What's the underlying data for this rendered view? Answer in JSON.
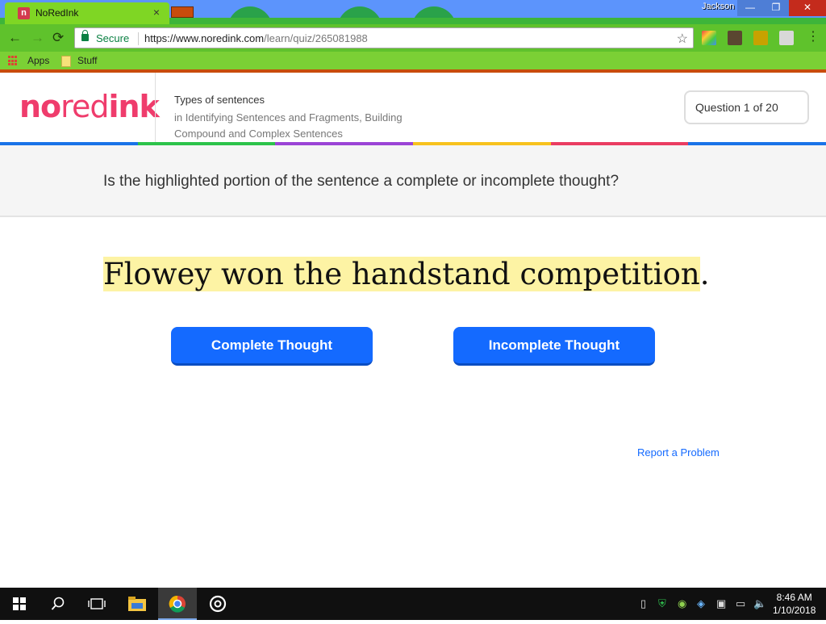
{
  "browser": {
    "tab_title": "NoRedInk",
    "tab_close": "×",
    "favicon_letter": "n",
    "profile_name": "Jackson",
    "window_buttons": {
      "minimize": "—",
      "maximize": "❐",
      "close": "✕"
    },
    "nav": {
      "back": "←",
      "forward": "→",
      "reload": "⟳"
    },
    "secure_label": "Secure",
    "url_host": "https://www.noredink.com",
    "url_path": "/learn/quiz/265081988",
    "star": "☆",
    "menu": "⋮",
    "bookmarks": [
      {
        "label": "Apps"
      },
      {
        "label": "Stuff"
      }
    ]
  },
  "header": {
    "logo": {
      "part1": "no",
      "part2": "red",
      "part3": "ink"
    },
    "topic": "Types of sentences",
    "topic_sub": "in Identifying Sentences and Fragments, Building Compound and Complex Sentences",
    "question_counter": "Question 1 of 20"
  },
  "colors": {
    "brand": "#ef3c6c",
    "button_blue": "#146aff",
    "highlight": "#fdf3a4",
    "rainbow": [
      "#1a73e8",
      "#2cc34a",
      "#9b44d6",
      "#f7c21d",
      "#ea3d62",
      "#1a73e8"
    ]
  },
  "quiz": {
    "prompt": "Is the highlighted portion of the sentence a complete or incomplete thought?",
    "sentence_highlighted": "Flowey won the handstand competition",
    "sentence_tail": ".",
    "answers": [
      {
        "label": "Complete Thought"
      },
      {
        "label": "Incomplete Thought"
      }
    ],
    "report_link": "Report a Problem"
  },
  "taskbar": {
    "time": "8:46 AM",
    "date": "1/10/2018",
    "icons": [
      "windows-start-icon",
      "search-icon",
      "task-view-icon",
      "file-explorer-icon",
      "chrome-icon",
      "groove-icon"
    ]
  }
}
